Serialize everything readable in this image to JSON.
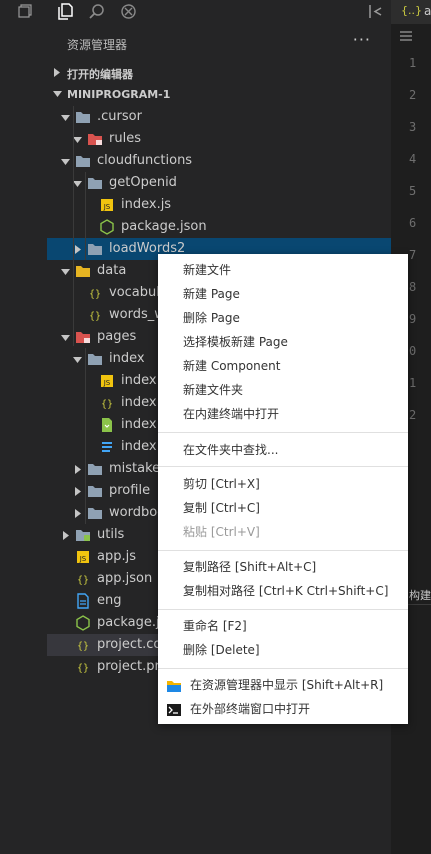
{
  "panel": {
    "title": "资源管理器",
    "more": "···"
  },
  "sections": {
    "open_editors": "打开的编辑器",
    "project": "MINIPROGRAM-1"
  },
  "tree": {
    "cursor": ".cursor",
    "rules": "rules",
    "cloudfunctions": "cloudfunctions",
    "getOpenid": "getOpenid",
    "index_js": "index.js",
    "package_json": "package.json",
    "loadWords2": "loadWords2",
    "data": "data",
    "vocabul": "vocabul",
    "words_w": "words_w",
    "pages": "pages",
    "index": "index",
    "index_j1": "index.j",
    "index_j2": "index.j",
    "index_w1": "index.w",
    "index_w2": "index.w",
    "mistakes": "mistakes",
    "profile": "profile",
    "wordbo": "wordboo",
    "utils": "utils",
    "app_js": "app.js",
    "app_json": "app.json",
    "eng": "eng",
    "package_j": "package.j",
    "project_co": "project.co",
    "project_pr": "project.pr"
  },
  "icons": {
    "file_js": "js-file-icon",
    "file_json": "json-file-icon",
    "folder": "folder-icon"
  },
  "colors": {
    "selected": "#094771",
    "folder": "#8fa1b3",
    "js": "#f1c40f",
    "json": "#cbcb41",
    "green": "#8bc34a",
    "blue": "#42a5f5"
  },
  "editor": {
    "tab_prefix": "{..}",
    "tab_letter": "a",
    "line_numbers": [
      "1",
      "2",
      "3",
      "4",
      "5",
      "6",
      "7",
      "8",
      "9",
      "0",
      "1",
      "2"
    ],
    "bottom_tab": "构建"
  },
  "menu": {
    "new_file": "新建文件",
    "new_page": "新建 Page",
    "delete_page": "删除 Page",
    "template_page": "选择模板新建 Page",
    "new_component": "新建 Component",
    "new_folder": "新建文件夹",
    "open_terminal": "在内建终端中打开",
    "find_in_folder": "在文件夹中查找...",
    "cut": "剪切  [Ctrl+X]",
    "copy": "复制  [Ctrl+C]",
    "paste": "粘贴  [Ctrl+V]",
    "copy_path": "复制路径  [Shift+Alt+C]",
    "copy_rel_path": "复制相对路径  [Ctrl+K Ctrl+Shift+C]",
    "rename": "重命名  [F2]",
    "delete": "删除  [Delete]",
    "reveal": "在资源管理器中显示  [Shift+Alt+R]",
    "open_external": "在外部终端窗口中打开"
  }
}
